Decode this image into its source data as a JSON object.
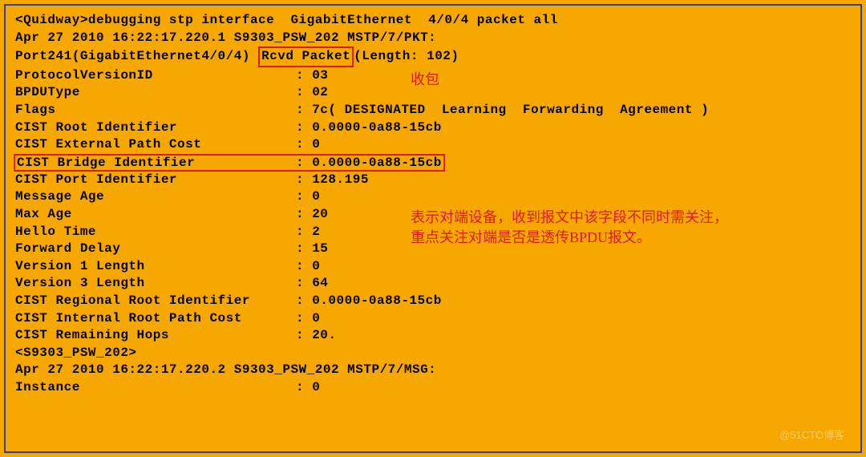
{
  "command": "<Quidway>debugging stp interface  GigabitEthernet  4/0/4 packet all",
  "timestamp_line": "Apr 27 2010 16:22:17.220.1 S9303_PSW_202 MSTP/7/PKT:",
  "port_prefix": "Port241(GigabitEthernet4/0/4) ",
  "rcvd_packet": "Rcvd Packet",
  "length_suffix": "(Length: 102)",
  "annotation_rcvd": "收包",
  "annotation_bridge_line1": "表示对端设备，收到报文中该字段不同时需关注，",
  "annotation_bridge_line2": "重点关注对端是否是透传BPDU报文。",
  "fields": {
    "protocol_version_id": {
      "label": "ProtocolVersionID",
      "value": ": 03"
    },
    "bpdu_type": {
      "label": "BPDUType",
      "value": ": 02"
    },
    "flags": {
      "label": "Flags",
      "value": ": 7c( DESIGNATED  Learning  Forwarding  Agreement )"
    },
    "cist_root_id": {
      "label": "CIST Root Identifier",
      "value": ": 0.0000-0a88-15cb"
    },
    "cist_ext_path_cost": {
      "label": "CIST External Path Cost",
      "value": ": 0"
    },
    "cist_bridge_id": {
      "label": "CIST Bridge Identifier",
      "value": ": 0.0000-0a88-15cb"
    },
    "cist_port_id": {
      "label": "CIST Port Identifier",
      "value": ": 128.195"
    },
    "message_age": {
      "label": "Message Age",
      "value": ": 0"
    },
    "max_age": {
      "label": "Max Age",
      "value": ": 20"
    },
    "hello_time": {
      "label": "Hello Time",
      "value": ": 2"
    },
    "forward_delay": {
      "label": "Forward Delay",
      "value": ": 15"
    },
    "version_1_length": {
      "label": "Version 1 Length",
      "value": ": 0"
    },
    "version_3_length": {
      "label": "Version 3 Length",
      "value": ": 64"
    },
    "cist_regional_root_id": {
      "label": "CIST Regional Root Identifier",
      "value": ": 0.0000-0a88-15cb"
    },
    "cist_internal_root_path": {
      "label": "CIST Internal Root Path Cost",
      "value": ": 0"
    },
    "cist_remaining_hops": {
      "label": "CIST Remaining Hops",
      "value": ": 20."
    }
  },
  "prompt_line": "<S9303_PSW_202>",
  "timestamp_line2": "Apr 27 2010 16:22:17.220.2 S9303_PSW_202 MSTP/7/MSG:",
  "instance": {
    "label": "Instance",
    "value": ": 0"
  },
  "watermark": "@51CTO博客"
}
